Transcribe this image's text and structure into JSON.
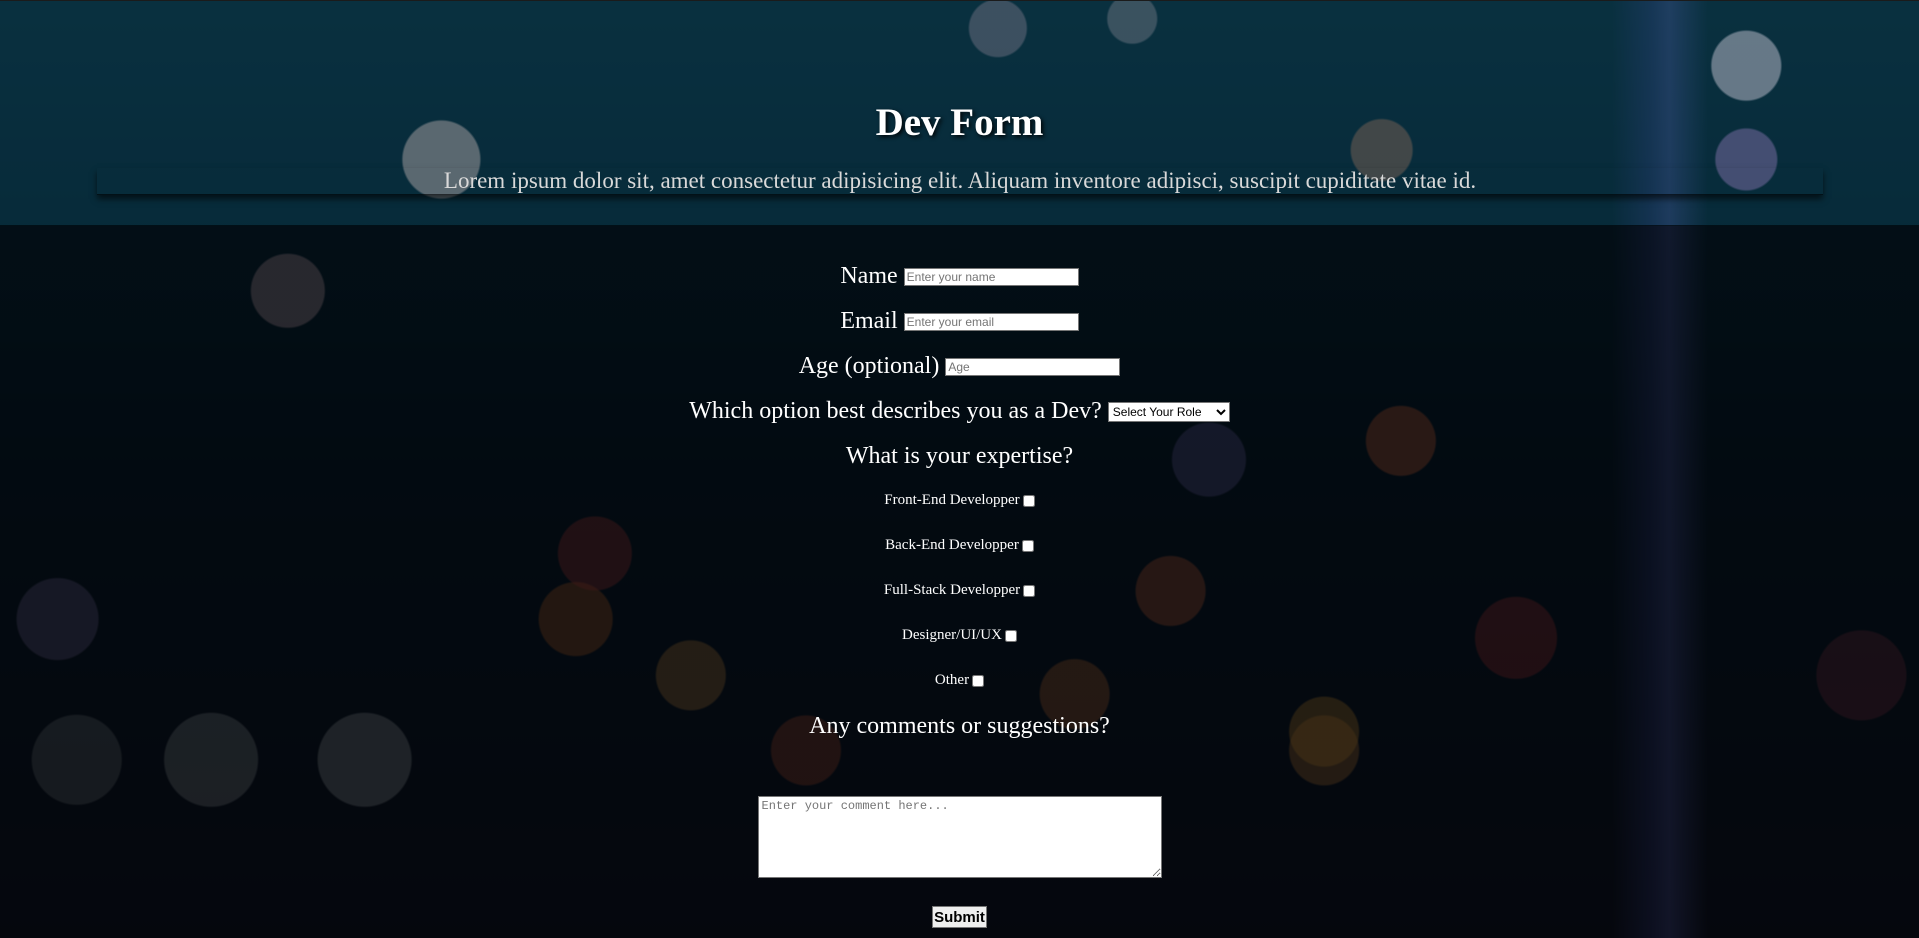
{
  "header": {
    "title": "Dev Form",
    "description": "Lorem ipsum dolor sit, amet consectetur adipisicing elit. Aliquam inventore adipisci, suscipit cupiditate vitae id."
  },
  "form": {
    "name": {
      "label": "Name",
      "placeholder": "Enter your name",
      "value": ""
    },
    "email": {
      "label": "Email",
      "placeholder": "Enter your email",
      "value": ""
    },
    "age": {
      "label": "Age (optional)",
      "placeholder": "Age",
      "value": ""
    },
    "role": {
      "label": "Which option best describes you as a Dev?",
      "selected": "Select Your Role"
    },
    "expertise": {
      "heading": "What is your expertise?",
      "options": [
        {
          "label": "Front-End Developper",
          "checked": false
        },
        {
          "label": "Back-End Developper",
          "checked": false
        },
        {
          "label": "Full-Stack Developper",
          "checked": false
        },
        {
          "label": "Designer/UI/UX",
          "checked": false
        },
        {
          "label": "Other",
          "checked": false
        }
      ]
    },
    "comments": {
      "heading": "Any comments or suggestions?",
      "placeholder": "Enter your comment here..."
    },
    "submit_label": "Submit"
  },
  "colors": {
    "header_band": "#0b3a4c",
    "text": "#ffffff",
    "description_text": "#d9d9d9"
  }
}
